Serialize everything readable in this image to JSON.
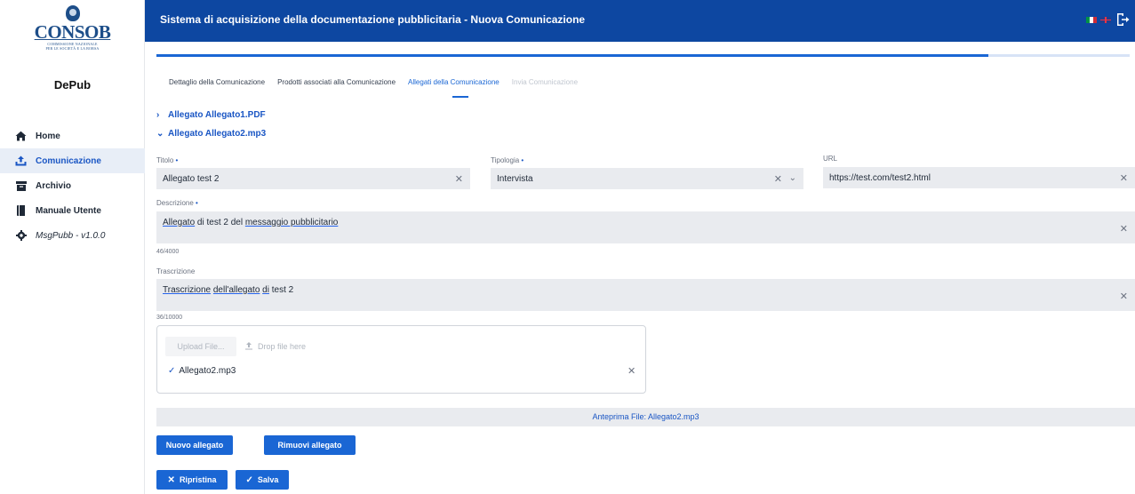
{
  "app": {
    "title": "Sistema di acquisizione della documentazione pubblicitaria - Nuova Comunicazione",
    "logo_text": "CONSOB",
    "logo_subtext_line1": "COMMISSIONE NAZIONALE",
    "logo_subtext_line2": "PER LE SOCIETÀ E LA BORSA",
    "brand": "DePub",
    "header_color": "#0d47a1",
    "accent_color": "#1a66d4"
  },
  "sidebar": {
    "items": [
      {
        "label": "Home",
        "icon": "home-icon"
      },
      {
        "label": "Comunicazione",
        "icon": "upload-icon"
      },
      {
        "label": "Archivio",
        "icon": "archive-icon"
      },
      {
        "label": "Manuale Utente",
        "icon": "book-icon"
      },
      {
        "label": "MsgPubb - v1.0.0",
        "icon": "gear-icon"
      }
    ],
    "active_index": 1
  },
  "progress": {
    "value": 0.855
  },
  "tabs": [
    {
      "label": "Dettaglio della Comunicazione",
      "state": "normal"
    },
    {
      "label": "Prodotti associati alla Comunicazione",
      "state": "normal"
    },
    {
      "label": "Allegati della Comunicazione",
      "state": "active"
    },
    {
      "label": "Invia Comunicazione",
      "state": "disabled"
    }
  ],
  "attachments": [
    {
      "title": "Allegato Allegato1.PDF",
      "expanded": false
    },
    {
      "title": "Allegato Allegato2.mp3",
      "expanded": true
    }
  ],
  "form": {
    "titolo": {
      "label": "Titolo",
      "required": "•",
      "value": "Allegato test 2"
    },
    "tipologia": {
      "label": "Tipologia",
      "required": "•",
      "value": "Intervista"
    },
    "url": {
      "label": "URL",
      "value": "https://test.com/test2.html"
    },
    "descrizione": {
      "label": "Descrizione",
      "required": "•",
      "value_part1": "Allegato",
      "value_part2": " di test 2 del ",
      "value_part3": "messaggio pubblicitario",
      "counter": "46/4000"
    },
    "trascrizione": {
      "label": "Trascrizione",
      "value_part1": "Trascrizione",
      "value_part2": " ",
      "value_part3": "dell'allegato",
      "value_part4": " ",
      "value_part5": "di",
      "value_part6": " test 2",
      "counter": "36/10000"
    }
  },
  "upload": {
    "button_label": "Upload File...",
    "drop_label": "Drop file here",
    "file_name": "Allegato2.mp3"
  },
  "preview": {
    "label": "Anteprima File: Allegato2.mp3"
  },
  "buttons": {
    "nuovo": "Nuovo allegato",
    "rimuovi": "Rimuovi allegato",
    "ripristina": "Ripristina",
    "salva": "Salva"
  }
}
